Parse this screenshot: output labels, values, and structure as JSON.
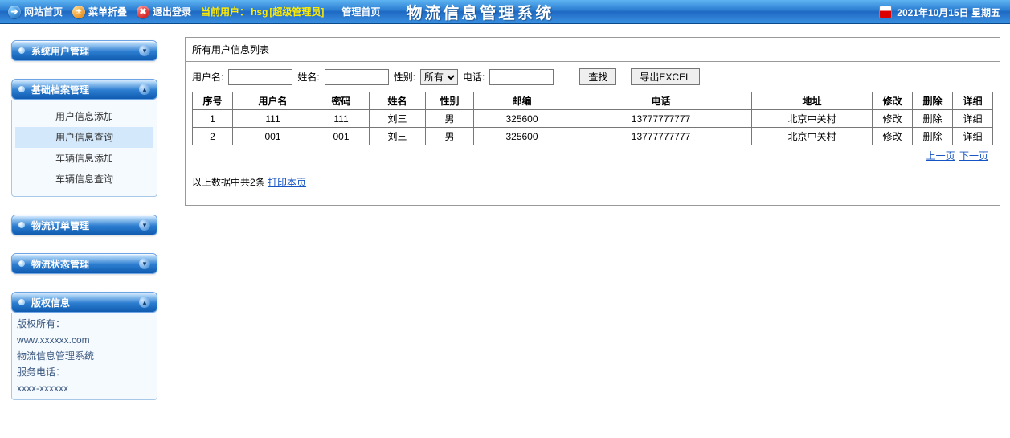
{
  "topbar": {
    "home": "网站首页",
    "collapse": "菜单折叠",
    "logout": "退出登录",
    "current_user_label": "当前用户：",
    "current_user": "hsg",
    "current_role": "[超级管理员]",
    "admin_home": "管理首页",
    "system_title": "物流信息管理系统",
    "date_text": "2021年10月15日 星期五"
  },
  "sidebar": {
    "groups": [
      {
        "title": "系统用户管理",
        "expanded": false
      },
      {
        "title": "基础档案管理",
        "expanded": true,
        "items": [
          "用户信息添加",
          "用户信息查询",
          "车辆信息添加",
          "车辆信息查询"
        ],
        "active_index": 1
      },
      {
        "title": "物流订单管理",
        "expanded": false
      },
      {
        "title": "物流状态管理",
        "expanded": false
      },
      {
        "title": "版权信息",
        "expanded": true,
        "is_copyright": true
      }
    ],
    "copyright": {
      "line1": "版权所有：",
      "line2": "www.xxxxxx.com",
      "line3": "物流信息管理系统",
      "line4": "服务电话：",
      "line5": "xxxx-xxxxxx"
    }
  },
  "main": {
    "list_title": "所有用户信息列表",
    "filters": {
      "username_label": "用户名:",
      "name_label": "姓名:",
      "gender_label": "性别:",
      "gender_value": "所有",
      "phone_label": "电话:",
      "search_btn": "查找",
      "export_btn": "导出EXCEL"
    },
    "columns": [
      "序号",
      "用户名",
      "密码",
      "姓名",
      "性别",
      "邮编",
      "电话",
      "地址",
      "修改",
      "删除",
      "详细"
    ],
    "rows": [
      {
        "idx": "1",
        "username": "111",
        "password": "111",
        "name": "刘三",
        "gender": "男",
        "zip": "325600",
        "phone": "13777777777",
        "addr": "北京中关村",
        "edit": "修改",
        "del": "删除",
        "detail": "详细"
      },
      {
        "idx": "2",
        "username": "001",
        "password": "001",
        "name": "刘三",
        "gender": "男",
        "zip": "325600",
        "phone": "13777777777",
        "addr": "北京中关村",
        "edit": "修改",
        "del": "删除",
        "detail": "详细"
      }
    ],
    "pager_prev": "上一页",
    "pager_next": "下一页",
    "summary_prefix": "以上数据中共",
    "summary_count": "2",
    "summary_suffix": "条 ",
    "print_link": "打印本页"
  }
}
